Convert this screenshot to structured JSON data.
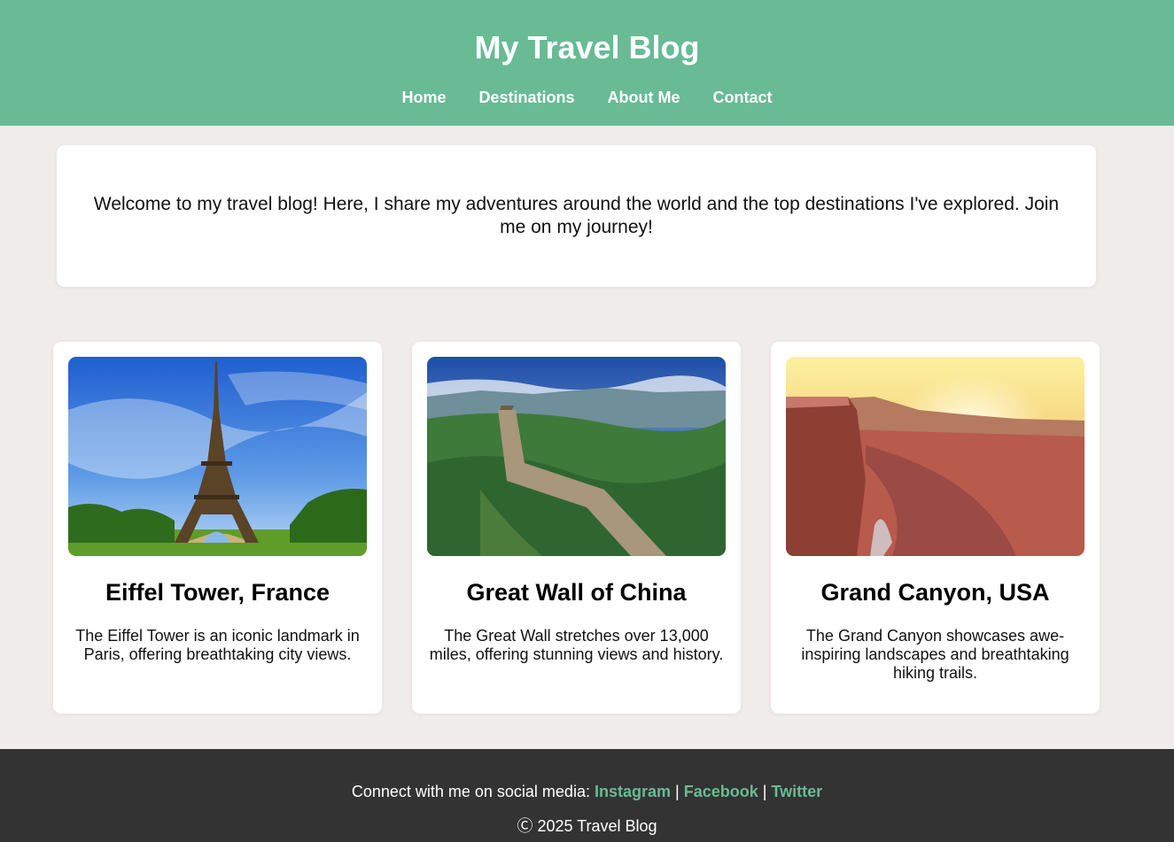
{
  "header": {
    "title": "My Travel Blog",
    "nav": [
      "Home",
      "Destinations",
      "About Me",
      "Contact"
    ]
  },
  "intro": {
    "text": "Welcome to my travel blog! Here, I share my adventures around the world and the top destinations I've explored. Join me on my journey!"
  },
  "destinations": [
    {
      "title": "Eiffel Tower, France",
      "description": "The Eiffel Tower is an iconic landmark in Paris, offering breathtaking city views.",
      "image_icon": "eiffel-tower-photo"
    },
    {
      "title": "Great Wall of China",
      "description": "The Great Wall stretches over 13,000 miles, offering stunning views and history.",
      "image_icon": "great-wall-photo"
    },
    {
      "title": "Grand Canyon, USA",
      "description": "The Grand Canyon showcases awe-inspiring landscapes and breathtaking hiking trails.",
      "image_icon": "grand-canyon-photo"
    }
  ],
  "footer": {
    "social_prefix": "Connect with me on social media:",
    "separator": "|",
    "links": [
      "Instagram",
      "Facebook",
      "Twitter"
    ],
    "copyright": "Ⓒ 2025 Travel Blog"
  },
  "colors": {
    "header_bg": "#68bb95",
    "page_bg": "#f1ecec",
    "footer_bg": "#333333",
    "link_accent": "#68bb95"
  }
}
